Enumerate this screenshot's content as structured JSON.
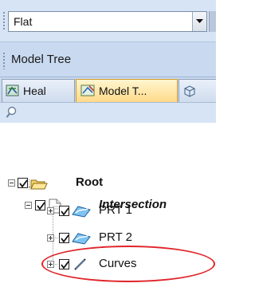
{
  "dropdown": {
    "value": "Flat"
  },
  "panel": {
    "title": "Model Tree"
  },
  "tabs": [
    {
      "label": "Heal",
      "icon": "heal-tool-icon"
    },
    {
      "label": "Model T...",
      "icon": "model-tree-icon"
    },
    {
      "label": "",
      "icon": "cube-icon"
    }
  ],
  "search": {
    "icon": "magnifier-icon"
  },
  "tree": {
    "root": {
      "label": "Root",
      "checked": true,
      "icon": "folder-open-icon"
    },
    "intersection": {
      "label": "Intersection",
      "checked": true,
      "icon": "document-icon"
    },
    "children": [
      {
        "label": "PRT 1",
        "checked": true,
        "icon": "surface-part-icon"
      },
      {
        "label": "PRT 2",
        "checked": true,
        "icon": "surface-part-icon"
      },
      {
        "label": "Curves",
        "checked": true,
        "icon": "curve-icon"
      }
    ]
  },
  "colors": {
    "highlight_circle": "#e0242a",
    "active_tab": "#ffd98a"
  }
}
